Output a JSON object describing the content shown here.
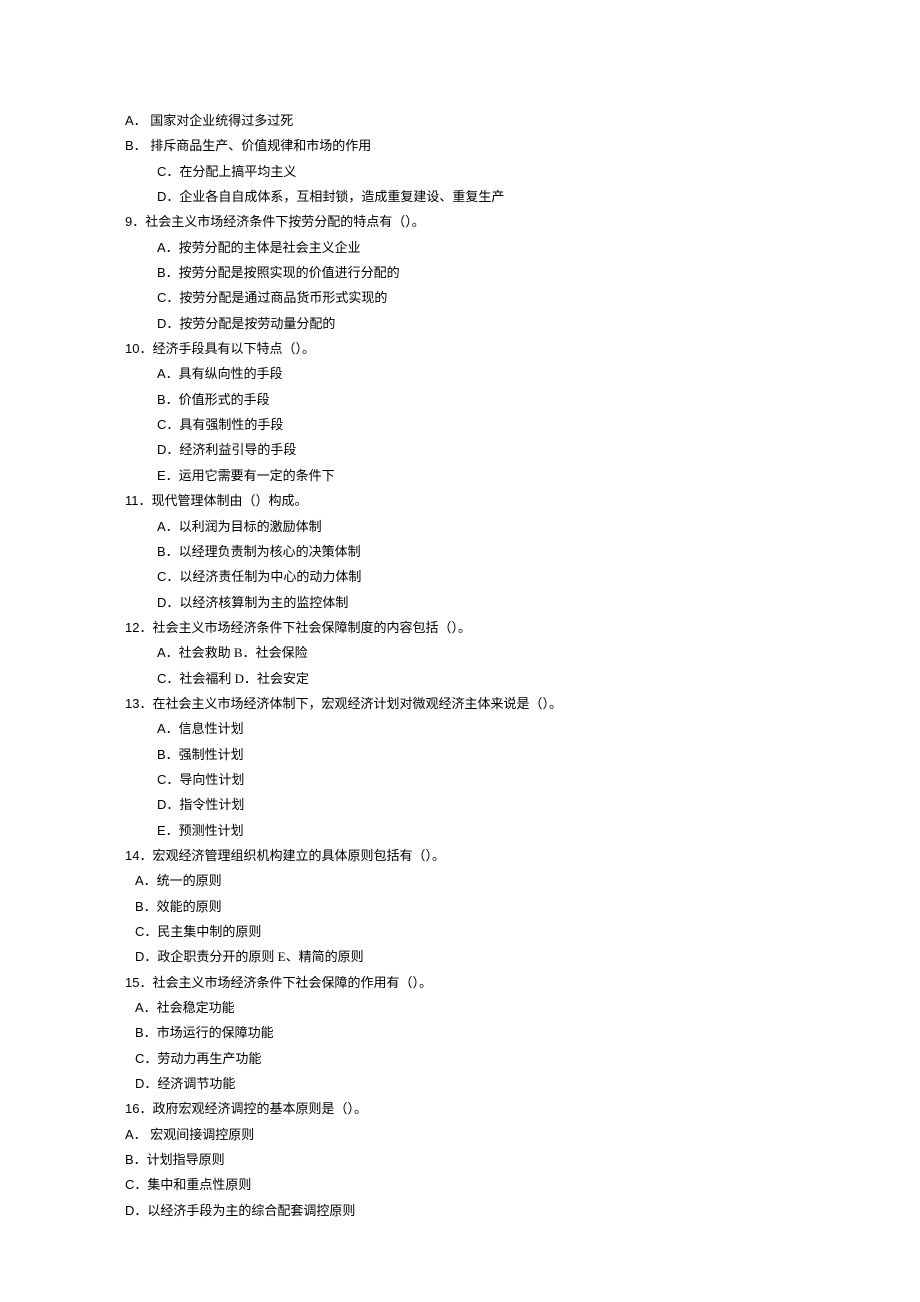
{
  "lines": [
    {
      "cls": "indent-1",
      "pre": "A．  ",
      "text": "国家对企业统得过多过死"
    },
    {
      "cls": "indent-1",
      "pre": "B．  ",
      "text": "排斥商品生产、价值规律和市场的作用"
    },
    {
      "cls": "indent-2",
      "pre": "C．",
      "text": "在分配上搞平均主义"
    },
    {
      "cls": "indent-2",
      "pre": "D．",
      "text": "企业各自自成体系，互相封锁，造成重复建设、重复生产"
    },
    {
      "cls": "indent-1",
      "pre": "9．",
      "text": "社会主义市场经济条件下按劳分配的特点有（）。"
    },
    {
      "cls": "indent-2",
      "pre": "A．",
      "text": "按劳分配的主体是社会主义企业"
    },
    {
      "cls": "indent-2",
      "pre": "B．",
      "text": "按劳分配是按照实现的价值进行分配的"
    },
    {
      "cls": "indent-2",
      "pre": "C．",
      "text": "按劳分配是通过商品货币形式实现的"
    },
    {
      "cls": "indent-2",
      "pre": "D．",
      "text": "按劳分配是按劳动量分配的"
    },
    {
      "cls": "indent-1",
      "pre": "10．",
      "text": "经济手段具有以下特点（）。"
    },
    {
      "cls": "indent-2",
      "pre": "A．",
      "text": "具有纵向性的手段"
    },
    {
      "cls": "indent-2",
      "pre": "B．",
      "text": "价值形式的手段"
    },
    {
      "cls": "indent-2",
      "pre": "C．",
      "text": "具有强制性的手段"
    },
    {
      "cls": "indent-2",
      "pre": "D．",
      "text": "经济利益引导的手段"
    },
    {
      "cls": "indent-2",
      "pre": "E．",
      "text": "运用它需要有一定的条件下"
    },
    {
      "cls": "indent-1",
      "pre": "11．",
      "text": "现代管理体制由（）构成。"
    },
    {
      "cls": "indent-2",
      "pre": "A．",
      "text": "以利润为目标的激励体制"
    },
    {
      "cls": "indent-2",
      "pre": "B．",
      "text": "以经理负责制为核心的决策体制"
    },
    {
      "cls": "indent-2",
      "pre": "C．",
      "text": "以经济责任制为中心的动力体制"
    },
    {
      "cls": "indent-2",
      "pre": "D．",
      "text": "以经济核算制为主的监控体制"
    },
    {
      "cls": "indent-1",
      "pre": "12．",
      "text": "社会主义市场经济条件下社会保障制度的内容包括（）。"
    },
    {
      "cls": "indent-2",
      "pre": "A．",
      "text": "社会救助 B．社会保险"
    },
    {
      "cls": "indent-2",
      "pre": "C．",
      "text": "社会福利 D．社会安定"
    },
    {
      "cls": "indent-1",
      "pre": "13．",
      "text": "在社会主义市场经济体制下，宏观经济计划对微观经济主体来说是（）。"
    },
    {
      "cls": "indent-2",
      "pre": "A．",
      "text": "信息性计划"
    },
    {
      "cls": "indent-2",
      "pre": "B．",
      "text": "强制性计划"
    },
    {
      "cls": "indent-2",
      "pre": "C．",
      "text": "导向性计划"
    },
    {
      "cls": "indent-2",
      "pre": "D．",
      "text": "指令性计划"
    },
    {
      "cls": "indent-2",
      "pre": "E．",
      "text": "预测性计划"
    },
    {
      "cls": "indent-1",
      "pre": "14．",
      "text": "宏观经济管理组织机构建立的具体原则包括有（）。"
    },
    {
      "cls": "indent-3",
      "pre": "A．",
      "text": "统一的原则"
    },
    {
      "cls": "indent-3",
      "pre": "B．",
      "text": "效能的原则"
    },
    {
      "cls": "indent-3",
      "pre": "C．",
      "text": "民主集中制的原则"
    },
    {
      "cls": "indent-3",
      "pre": "D．",
      "text": "政企职责分开的原则  E、精简的原则"
    },
    {
      "cls": "indent-1",
      "pre": "15．",
      "text": "社会主义市场经济条件下社会保障的作用有（）。"
    },
    {
      "cls": "indent-3",
      "pre": "A．",
      "text": "社会稳定功能"
    },
    {
      "cls": "indent-3",
      "pre": "B．",
      "text": "市场运行的保障功能"
    },
    {
      "cls": "indent-3",
      "pre": "C．",
      "text": "劳动力再生产功能"
    },
    {
      "cls": "indent-3",
      "pre": "D．",
      "text": "经济调节功能"
    },
    {
      "cls": "indent-1",
      "pre": "16．",
      "text": "政府宏观经济调控的基本原则是（）。"
    },
    {
      "cls": "indent-1",
      "pre": "A．  ",
      "text": "宏观间接调控原则"
    },
    {
      "cls": "indent-1",
      "pre": "B．",
      "text": "计划指导原则"
    },
    {
      "cls": "indent-1",
      "pre": "C．",
      "text": "集中和重点性原则"
    },
    {
      "cls": "indent-1",
      "pre": "D．",
      "text": "以经济手段为主的综合配套调控原则"
    }
  ]
}
